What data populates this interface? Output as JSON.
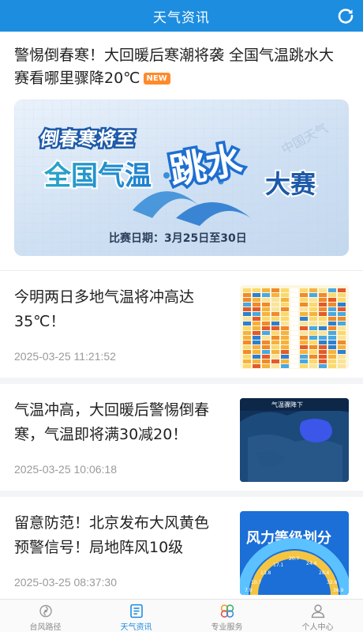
{
  "header": {
    "title": "天气资讯",
    "refresh_icon": "refresh-icon"
  },
  "featured": {
    "title": "警惕倒春寒！大回暖后寒潮将袭 全国气温跳水大赛看哪里骤降20℃",
    "badge": "NEW",
    "banner": {
      "line1": "倒春寒将至",
      "line2a": "全国气温",
      "line2b": "跳水",
      "line2c": "大赛",
      "date_text": "比赛日期：3月25日至30日",
      "watermark": "中国天气"
    }
  },
  "news": [
    {
      "title": "今明两日多地气温将冲高达35℃！",
      "date": "2025-03-25 11:21:52",
      "thumb": "temperature-table-thumbnail"
    },
    {
      "title": "气温冲高，大回暖后警惕倒春寒，气温即将满30减20！",
      "date": "2025-03-25 10:06:18",
      "thumb": "temperature-drop-map-thumbnail",
      "thumb_caption": "气温骤降下"
    },
    {
      "title": "留意防范！北京发布大风黄色预警信号！局地阵风10级",
      "date": "2025-03-25 08:37:30",
      "thumb": "wind-scale-thumbnail",
      "thumb_caption": "风力等级划分",
      "thumb_values": [
        "17.1",
        "20.7",
        "24.4",
        "13.8",
        "28.4",
        "10.7",
        "32.6",
        "7.9",
        "36.9"
      ]
    }
  ],
  "tabs": [
    {
      "label": "台风路径",
      "icon": "typhoon-icon",
      "active": false
    },
    {
      "label": "天气资讯",
      "icon": "news-icon",
      "active": true
    },
    {
      "label": "专业服务",
      "icon": "service-icon",
      "active": false
    },
    {
      "label": "个人中心",
      "icon": "user-icon",
      "active": false
    }
  ],
  "colors": {
    "header_bg": "#1d8de0",
    "active_tab": "#1d8de0",
    "badge_bg": "#ff8a2b",
    "date_text": "#9a9a9a"
  }
}
